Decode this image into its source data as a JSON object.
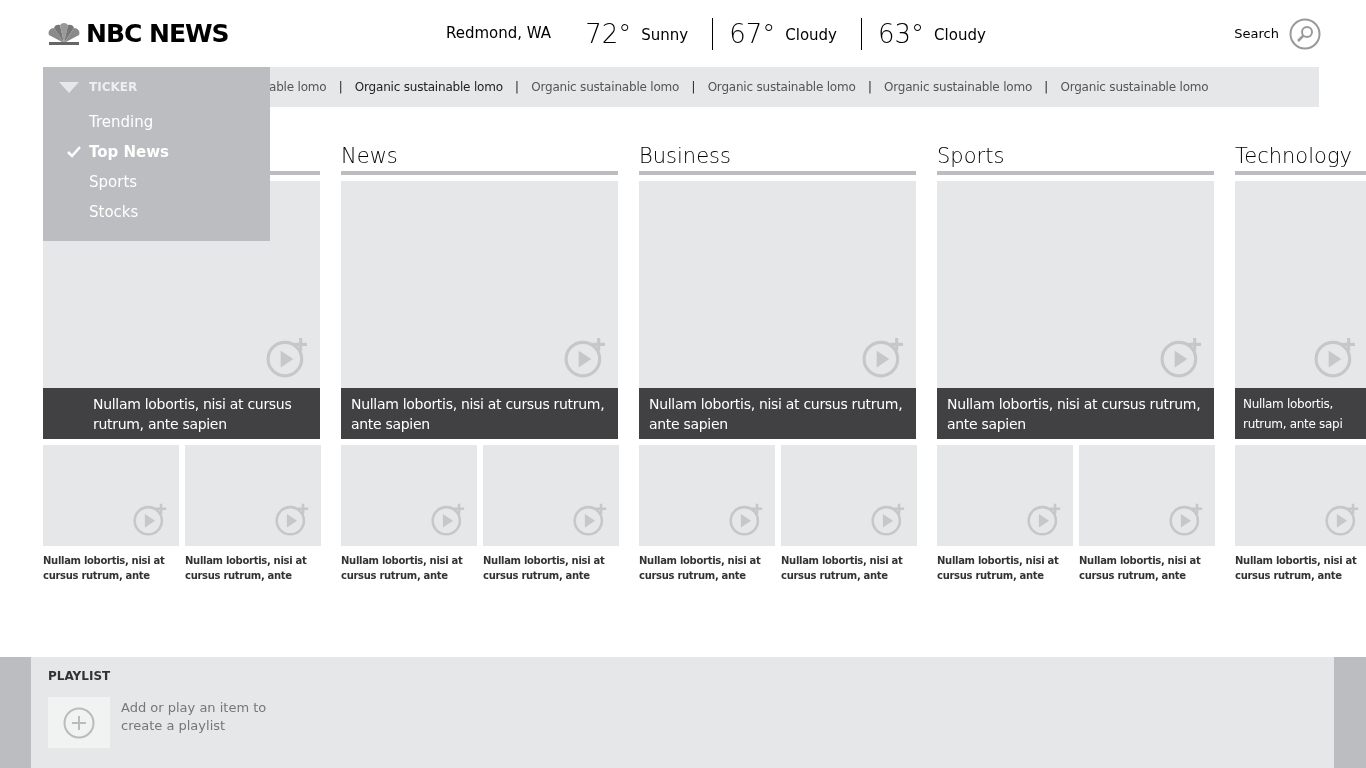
{
  "header": {
    "logo": "NBC NEWS",
    "location": "Redmond, WA",
    "weather": [
      {
        "temp": "72°",
        "condition": "Sunny"
      },
      {
        "temp": "67°",
        "condition": "Cloudy"
      },
      {
        "temp": "63°",
        "condition": "Cloudy"
      }
    ],
    "search_label": "Search"
  },
  "ticker": {
    "items": [
      {
        "text": "able lomo",
        "selected": false
      },
      {
        "text": "Organic sustainable lomo",
        "selected": true
      },
      {
        "text": "Organic sustainable lomo",
        "selected": false
      },
      {
        "text": "Organic sustainable lomo",
        "selected": false
      },
      {
        "text": "Organic sustainable lomo",
        "selected": false
      },
      {
        "text": "Organic sustainable lomo",
        "selected": false
      }
    ],
    "separator": "|"
  },
  "ticker_menu": {
    "title": "TICKER",
    "expanded": true,
    "items": [
      {
        "label": "Trending",
        "selected": false
      },
      {
        "label": "Top News",
        "selected": true
      },
      {
        "label": "Sports",
        "selected": false
      },
      {
        "label": "Stocks",
        "selected": false
      }
    ]
  },
  "sections": [
    {
      "feature": "Nullam lobortis, nisi at cursus rutrum, ante sapien",
      "items": [
        "Nullam lobortis, nisi at cursus rutrum, ante",
        "Nullam lobortis, nisi at cursus rutrum, ante"
      ]
    },
    {
      "title": "News",
      "feature": "Nullam lobortis, nisi at cursus rutrum, ante sapien",
      "items": [
        "Nullam lobortis, nisi at cursus rutrum, ante",
        "Nullam lobortis, nisi at cursus rutrum, ante"
      ]
    },
    {
      "title": "Business",
      "feature": "Nullam lobortis, nisi at cursus rutrum, ante sapien",
      "items": [
        "Nullam lobortis, nisi at cursus rutrum, ante",
        "Nullam lobortis, nisi at cursus rutrum, ante"
      ]
    },
    {
      "title": "Sports",
      "feature": "Nullam lobortis, nisi at cursus rutrum, ante sapien",
      "items": [
        "Nullam lobortis, nisi at cursus rutrum, ante",
        "Nullam lobortis, nisi at cursus rutrum, ante"
      ]
    },
    {
      "title": "Technology",
      "feature": "Nullam lobortis,\nrutrum, ante sapi",
      "items": [
        "Nullam lobortis, nisi at cursus rutrum, ante"
      ]
    }
  ],
  "playlist": {
    "title": "PLAYLIST",
    "hint": "Add or play an item to create a playlist"
  }
}
